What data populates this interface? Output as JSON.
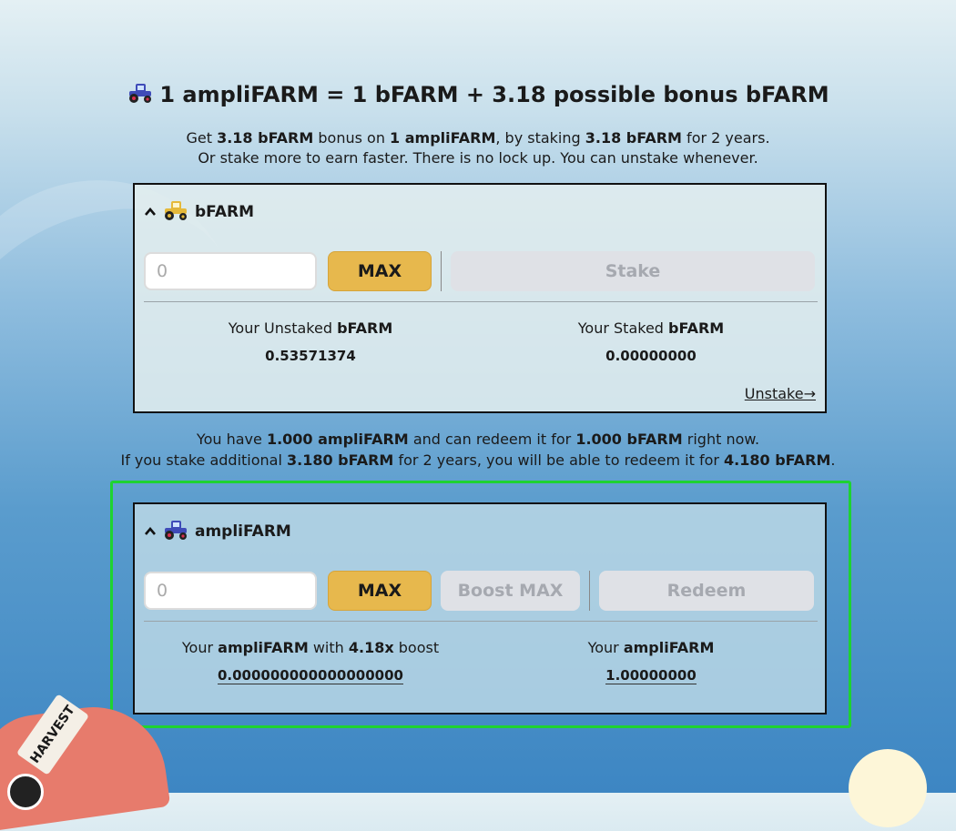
{
  "headline": {
    "text": "1 ampliFARM = 1 bFARM + 3.18 possible bonus bFARM",
    "icon": "tractor-icon"
  },
  "subtext": {
    "line1_a": "Get ",
    "line1_b": "3.18 bFARM",
    "line1_c": " bonus on ",
    "line1_d": "1 ampliFARM",
    "line1_e": ", by staking ",
    "line1_f": "3.18 bFARM",
    "line1_g": " for 2 years.",
    "line2": "Or stake more to earn faster. There is no lock up. You can unstake whenever."
  },
  "bfarm_panel": {
    "title": "bFARM",
    "icon": "yellow-tractor-icon",
    "input_placeholder": "0",
    "max_label": "MAX",
    "stake_label": "Stake",
    "unstaked_prefix": "Your Unstaked ",
    "unstaked_token": "bFARM",
    "unstaked_value": "0.53571374",
    "staked_prefix": "Your Staked ",
    "staked_token": "bFARM",
    "staked_value": "0.00000000",
    "unstake_link": "Unstake→"
  },
  "middle": {
    "l1_a": "You have ",
    "l1_b": "1.000 ampliFARM",
    "l1_c": " and can redeem it for ",
    "l1_d": "1.000 bFARM",
    "l1_e": " right now.",
    "l2_a": "If you stake additional ",
    "l2_b": "3.180 bFARM",
    "l2_c": " for 2 years, you will be able to redeem it for ",
    "l2_d": "4.180 bFARM",
    "l2_e": "."
  },
  "amplifarm_panel": {
    "title": "ampliFARM",
    "icon": "blue-tractor-icon",
    "input_placeholder": "0",
    "max_label": "MAX",
    "boost_max_label": "Boost MAX",
    "redeem_label": "Redeem",
    "boost_prefix": "Your ",
    "boost_token": "ampliFARM",
    "boost_mid": " with ",
    "boost_factor": "4.18x",
    "boost_suffix": " boost",
    "boost_value": "0.000000000000000000",
    "your_prefix": "Your ",
    "your_token": "ampliFARM",
    "your_value": "1.00000000"
  },
  "decor": {
    "tag_text": "HARVEST"
  },
  "colors": {
    "max_button": "#e7b84d",
    "highlight_border": "#1ed331",
    "disabled_button": "#dfe1e6"
  }
}
